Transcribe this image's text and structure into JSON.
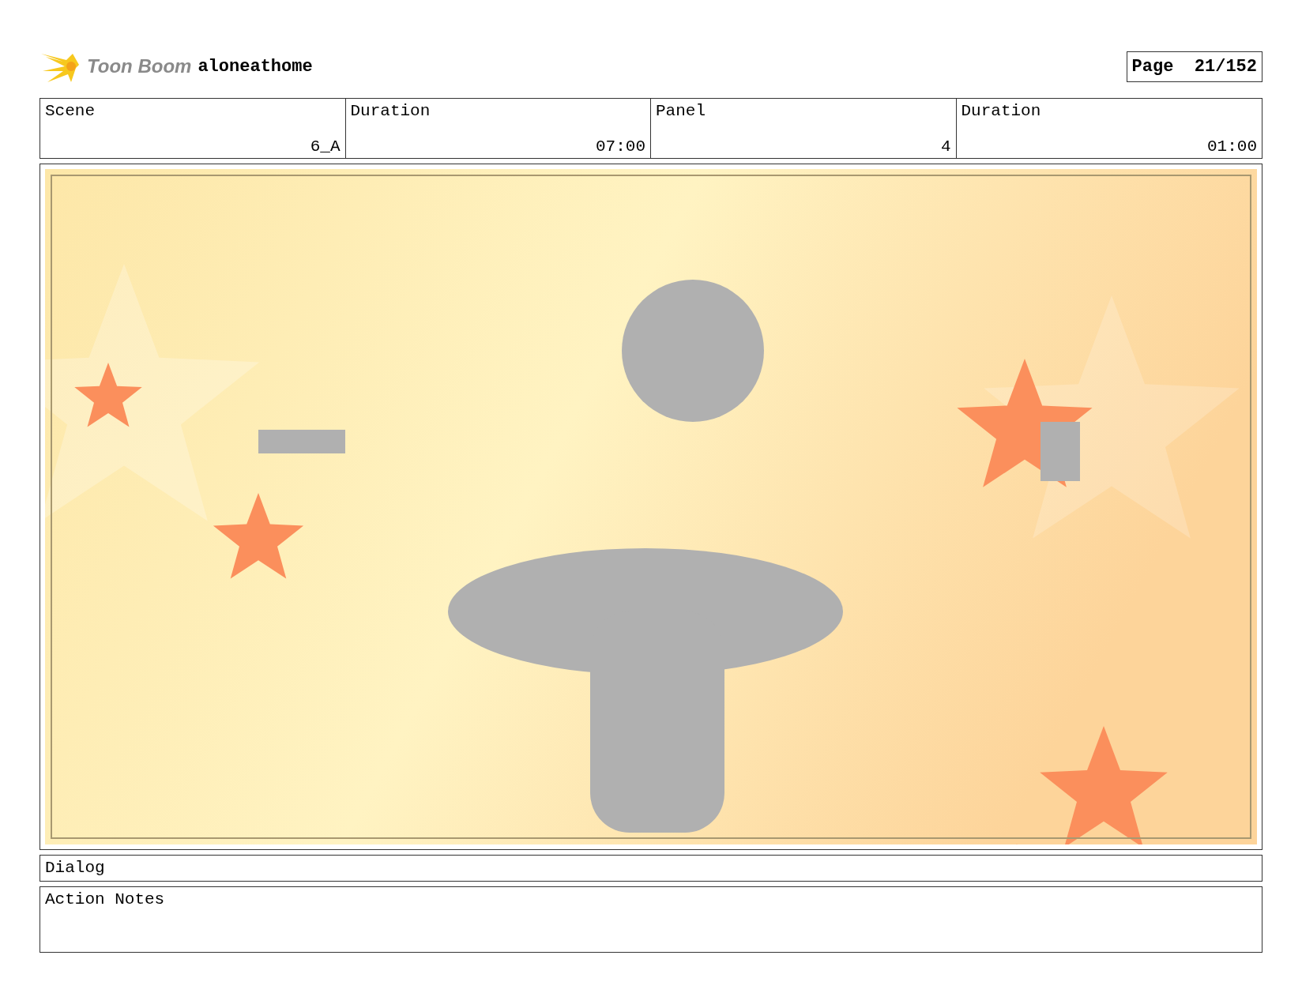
{
  "header": {
    "logo_text": "Toon Boom",
    "project": "aloneathome",
    "page_label": "Page",
    "page_number": "21/152"
  },
  "info_table": {
    "columns": [
      "Scene",
      "Duration",
      "Panel",
      "Duration"
    ],
    "rows": [
      [
        "6_A",
        "07:00",
        "4",
        "01:00"
      ]
    ]
  },
  "dialog": {
    "label": "Dialog"
  },
  "action_notes": {
    "label": "Action Notes"
  }
}
